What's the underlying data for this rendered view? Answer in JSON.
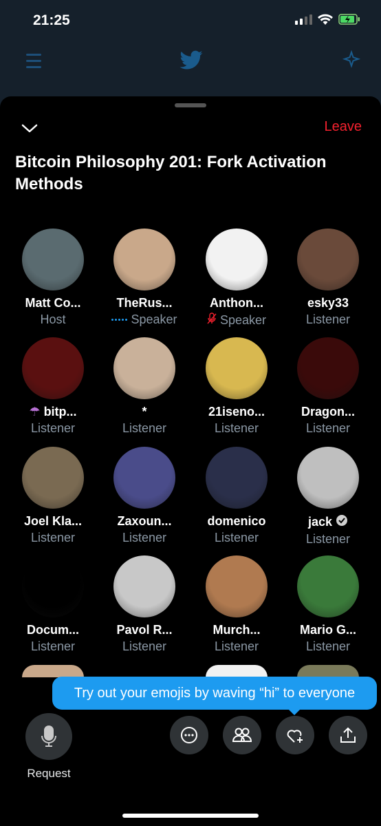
{
  "status_bar": {
    "time": "21:25"
  },
  "room": {
    "title": "Bitcoin Philosophy 201: Fork Activation Methods",
    "leave_label": "Leave"
  },
  "participants": [
    {
      "name": "Matt Co...",
      "role": "Host",
      "color": "#5a6b70"
    },
    {
      "name": "TheRus...",
      "role": "Speaker",
      "color": "#c9a88a",
      "indicator": "speaking-dots"
    },
    {
      "name": "Anthon...",
      "role": "Speaker",
      "color": "#f2f2f2",
      "indicator": "muted-mic"
    },
    {
      "name": "esky33",
      "role": "Listener",
      "color": "#6a4a3a"
    },
    {
      "name": "bitp...",
      "role": "Listener",
      "color": "#5a1010",
      "prefix_icon": "umbrella"
    },
    {
      "name": "*",
      "role": "Listener",
      "color": "#c9b19a"
    },
    {
      "name": "21iseno...",
      "role": "Listener",
      "color": "#d8b850"
    },
    {
      "name": "Dragon...",
      "role": "Listener",
      "color": "#3a0a0a"
    },
    {
      "name": "Joel Kla...",
      "role": "Listener",
      "color": "#7a6a52"
    },
    {
      "name": "Zaxoun...",
      "role": "Listener",
      "color": "#4a4c8a"
    },
    {
      "name": "domenico",
      "role": "Listener",
      "color": "#2a2f4a"
    },
    {
      "name": "jack",
      "role": "Listener",
      "color": "#bfbfbf",
      "verified": true
    },
    {
      "name": "Docum...",
      "role": "Listener",
      "color": "#000000"
    },
    {
      "name": "Pavol R...",
      "role": "Listener",
      "color": "#c8c8c8"
    },
    {
      "name": "Murch...",
      "role": "Listener",
      "color": "#b07a50"
    },
    {
      "name": "Mario G...",
      "role": "Listener",
      "color": "#3a7a3a"
    }
  ],
  "tooltip": {
    "text": "Try out your emojis by waving “hi” to everyone"
  },
  "controls": {
    "request_label": "Request"
  }
}
